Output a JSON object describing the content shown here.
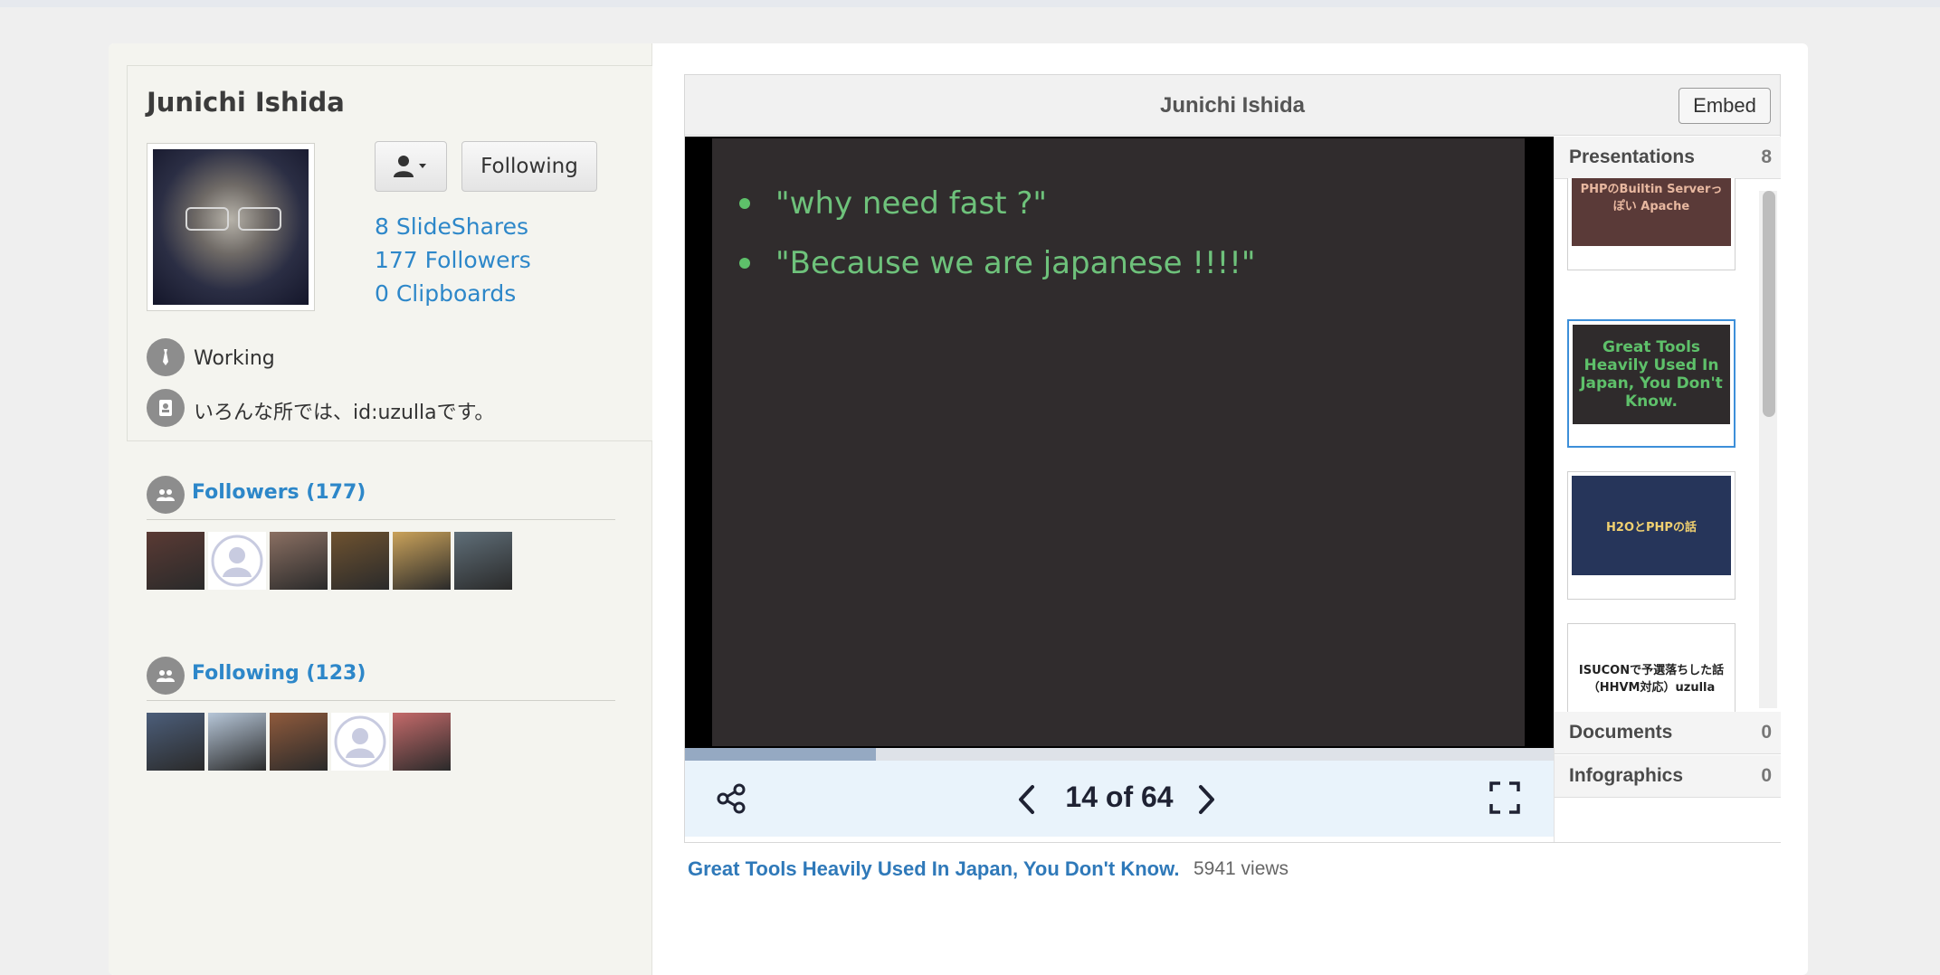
{
  "profile": {
    "name": "Junichi Ishida",
    "follow_label": "Following",
    "stats": {
      "slideshares": "8 SlideShares",
      "followers": "177 Followers",
      "clipboards": "0 Clipboards"
    },
    "status": "Working",
    "bio": "いろんな所では、id:uzullaです。"
  },
  "followers": {
    "title": "Followers (177)",
    "avatars": [
      "#5a3a34",
      "blank",
      "#8a6f62",
      "#6e5230",
      "#caa25a",
      "#5f6e78"
    ]
  },
  "following": {
    "title": "Following (123)",
    "avatars": [
      "#4c5e7a",
      "#b6c6d8",
      "#8f5a3c",
      "blank",
      "#c46a6a"
    ]
  },
  "player": {
    "title": "Junichi Ishida",
    "embed_label": "Embed",
    "slide_bullets": [
      "\"why need fast ?\"",
      "\"Because we are japanese !!!!\""
    ],
    "page_indicator": "14 of 64",
    "progress": 0.22,
    "colors": {
      "slide_bg": "#302c2d",
      "bullet": "#6ec27b",
      "accent": "#2d87c9"
    }
  },
  "panel": {
    "presentations_label": "Presentations",
    "presentations_count": "8",
    "documents_label": "Documents",
    "documents_count": "0",
    "infographics_label": "Infographics",
    "infographics_count": "0",
    "decks": [
      {
        "title": "PHPのBuiltin Serverっぽい Apache",
        "bg": "#5a3a38",
        "color": "#e8b8a0"
      },
      {
        "title": "Great Tools Heavily Used In Japan, You Don't Know.",
        "bg": "#2f2b2c",
        "color": "#5ec06a",
        "selected": true
      },
      {
        "title": "H2OとPHPの話",
        "bg": "#26355a",
        "color": "#f0d070"
      },
      {
        "title": "ISUCONで予選落ちした話（HHVM対応）uzulla",
        "bg": "#ffffff",
        "color": "#222222"
      }
    ]
  },
  "meta": {
    "title": "Great Tools Heavily Used In Japan, You Don't Know.",
    "views": "5941 views"
  }
}
